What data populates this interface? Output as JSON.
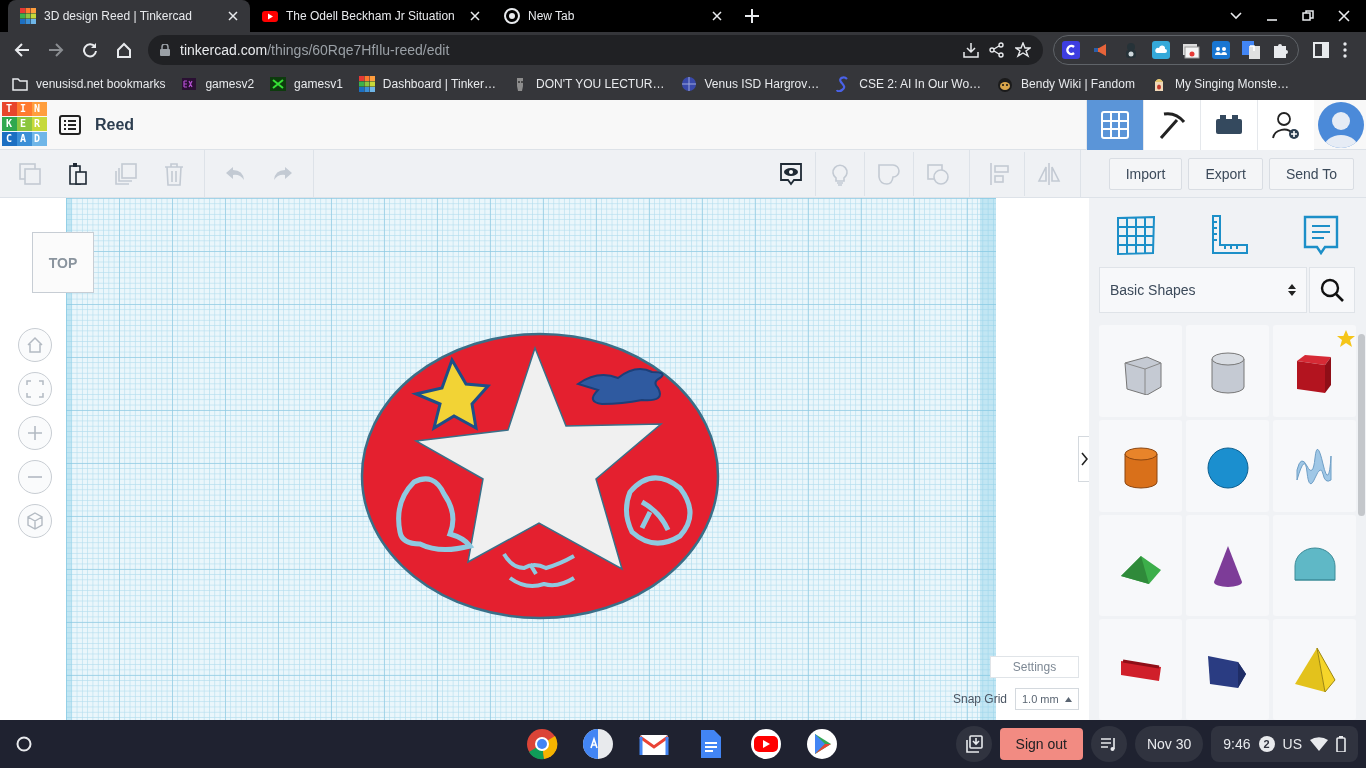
{
  "browser": {
    "tabs": [
      {
        "title": "3D design Reed | Tinkercad",
        "kind": "tinkercad",
        "selected": true
      },
      {
        "title": "The Odell Beckham Jr Situation",
        "kind": "youtube",
        "selected": false
      },
      {
        "title": "New Tab",
        "kind": "chrome",
        "selected": false
      }
    ],
    "url": {
      "host": "tinkercad.com",
      "path": "/things/60Rqe7HfIlu-reed/edit"
    },
    "bookmarks": [
      {
        "label": "venusisd.net bookmarks",
        "kind": "folder"
      },
      {
        "label": "gamesv2",
        "kind": "exe"
      },
      {
        "label": "gamesv1",
        "kind": "game"
      },
      {
        "label": "Dashboard | Tinker…",
        "kind": "tinkercad"
      },
      {
        "label": "DON'T YOU LECTUR…",
        "kind": "statue"
      },
      {
        "label": "Venus ISD Hargrov…",
        "kind": "globe"
      },
      {
        "label": "CSE 2: AI In Our Wo…",
        "kind": "s-logo"
      },
      {
        "label": "Bendy Wiki | Fandom",
        "kind": "face"
      },
      {
        "label": "My Singing Monste…",
        "kind": "monster"
      }
    ]
  },
  "app": {
    "logo": [
      "TIN",
      "KER",
      "CAD"
    ],
    "title": "Reed",
    "nav": [
      {
        "kind": "grid",
        "selected": true
      },
      {
        "kind": "pickaxe",
        "selected": false
      },
      {
        "kind": "brick",
        "selected": false
      },
      {
        "kind": "add-user",
        "selected": false
      }
    ]
  },
  "toolbar": {
    "edit_tools": [
      {
        "kind": "copy",
        "disabled": true
      },
      {
        "kind": "paste",
        "disabled": false
      },
      {
        "kind": "duplicate",
        "disabled": true
      },
      {
        "kind": "delete",
        "disabled": true
      }
    ],
    "history_tools": [
      {
        "kind": "undo",
        "disabled": true
      },
      {
        "kind": "redo",
        "disabled": true
      }
    ],
    "view_tools": [
      {
        "kind": "eye-bubble",
        "disabled": false
      },
      {
        "kind": "bulb",
        "disabled": true
      },
      {
        "kind": "group",
        "disabled": true
      },
      {
        "kind": "hole",
        "disabled": true
      }
    ],
    "arrange_tools": [
      {
        "kind": "align",
        "disabled": true
      },
      {
        "kind": "mirror",
        "disabled": true
      }
    ],
    "buttons": [
      "Import",
      "Export",
      "Send To"
    ]
  },
  "canvas": {
    "view_cube": "TOP",
    "settings": "Settings",
    "snap_grid": {
      "label": "Snap Grid",
      "value": "1.0 mm"
    }
  },
  "panel": {
    "category": "Basic Shapes",
    "shapes": [
      {
        "kind": "box-hole",
        "favorite": false
      },
      {
        "kind": "cylinder-hole",
        "favorite": false
      },
      {
        "kind": "box",
        "favorite": true
      },
      {
        "kind": "cylinder",
        "favorite": false
      },
      {
        "kind": "sphere",
        "favorite": false
      },
      {
        "kind": "scribble",
        "favorite": false
      },
      {
        "kind": "roof",
        "favorite": false
      },
      {
        "kind": "cone",
        "favorite": false
      },
      {
        "kind": "round-roof",
        "favorite": false
      },
      {
        "kind": "text",
        "favorite": false
      },
      {
        "kind": "wedge",
        "favorite": false
      },
      {
        "kind": "pyramid",
        "favorite": false
      }
    ]
  },
  "taskbar": {
    "sign_out": "Sign out",
    "date": "Nov 30",
    "time": "9:46",
    "notifications": "2",
    "input_method": "US"
  }
}
